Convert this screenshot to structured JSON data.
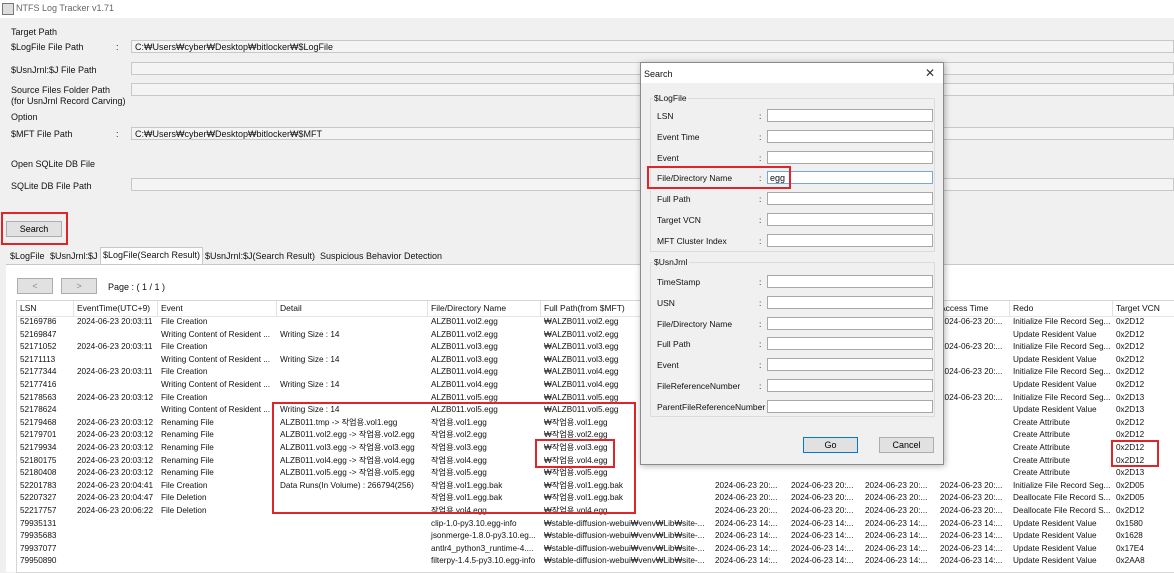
{
  "window": {
    "title": "NTFS Log Tracker v1.71"
  },
  "paths": {
    "target_path": "Target Path",
    "logfile_label": "$LogFile File Path",
    "logfile_value": "C:₩Users₩cyber₩Desktop₩bitlocker₩$LogFile",
    "usnjrnl_label": "$UsnJrnl:$J File Path",
    "usnjrnl_value": "",
    "source_label_1": "Source Files Folder Path",
    "source_label_2": "(for UsnJrnl Record Carving)",
    "source_value": "",
    "option": "Option",
    "mft_label": "$MFT File Path",
    "mft_value": "C:₩Users₩cyber₩Desktop₩bitlocker₩$MFT",
    "sqlite_open": "Open SQLite DB File",
    "sqlite_label": "SQLite DB File Path",
    "sqlite_value": "",
    "colon": ":"
  },
  "search_button": "Search",
  "tabs": [
    "$LogFile",
    "$UsnJrnl:$J",
    "$LogFile(Search Result)",
    "$UsnJrnl:$J(Search Result)",
    "Suspicious Behavior Detection"
  ],
  "active_tab": 2,
  "pager": {
    "prev": "<",
    "next": ">",
    "page_label": "Page : ( 1 / 1 )"
  },
  "table": {
    "columns": [
      "LSN",
      "EventTime(UTC+9)",
      "Event",
      "Detail",
      "File/Directory Name",
      "Full Path(from $MFT)",
      "",
      "",
      "",
      "Access Time",
      "Redo",
      "Target VCN"
    ],
    "rows": [
      [
        "52169786",
        "2024-06-23 20:03:11",
        "File Creation",
        "",
        "ALZB011.vol2.egg",
        "₩ALZB011.vol2.egg",
        "",
        "",
        "",
        "2024-06-23 20:...",
        "Initialize File Record Seg...",
        "0x2D12"
      ],
      [
        "52169847",
        "",
        "Writing Content of Resident ...",
        "Writing Size : 14",
        "ALZB011.vol2.egg",
        "₩ALZB011.vol2.egg",
        "",
        "",
        "",
        "",
        "Update Resident Value",
        "0x2D12"
      ],
      [
        "52171052",
        "2024-06-23 20:03:11",
        "File Creation",
        "",
        "ALZB011.vol3.egg",
        "₩ALZB011.vol3.egg",
        "",
        "",
        "",
        "2024-06-23 20:...",
        "Initialize File Record Seg...",
        "0x2D12"
      ],
      [
        "52171113",
        "",
        "Writing Content of Resident ...",
        "Writing Size : 14",
        "ALZB011.vol3.egg",
        "₩ALZB011.vol3.egg",
        "",
        "",
        "",
        "",
        "Update Resident Value",
        "0x2D12"
      ],
      [
        "52177344",
        "2024-06-23 20:03:11",
        "File Creation",
        "",
        "ALZB011.vol4.egg",
        "₩ALZB011.vol4.egg",
        "",
        "",
        "",
        "2024-06-23 20:...",
        "Initialize File Record Seg...",
        "0x2D12"
      ],
      [
        "52177416",
        "",
        "Writing Content of Resident ...",
        "Writing Size : 14",
        "ALZB011.vol4.egg",
        "₩ALZB011.vol4.egg",
        "",
        "",
        "",
        "",
        "Update Resident Value",
        "0x2D12"
      ],
      [
        "52178563",
        "2024-06-23 20:03:12",
        "File Creation",
        "",
        "ALZB011.vol5.egg",
        "₩ALZB011.vol5.egg",
        "",
        "",
        "",
        "2024-06-23 20:...",
        "Initialize File Record Seg...",
        "0x2D13"
      ],
      [
        "52178624",
        "",
        "Writing Content of Resident ...",
        "Writing Size : 14",
        "ALZB011.vol5.egg",
        "₩ALZB011.vol5.egg",
        "",
        "",
        "",
        "",
        "Update Resident Value",
        "0x2D13"
      ],
      [
        "52179468",
        "2024-06-23 20:03:12",
        "Renaming File",
        "ALZB011.tmp -> 작업용.vol1.egg",
        "작업용.vol1.egg",
        "₩작업용.vol1.egg",
        "",
        "",
        "",
        "",
        "Create Attribute",
        "0x2D12"
      ],
      [
        "52179701",
        "2024-06-23 20:03:12",
        "Renaming File",
        "ALZB011.vol2.egg -> 작업용.vol2.egg",
        "작업용.vol2.egg",
        "₩작업용.vol2.egg",
        "",
        "",
        "",
        "",
        "Create Attribute",
        "0x2D12"
      ],
      [
        "52179934",
        "2024-06-23 20:03:12",
        "Renaming File",
        "ALZB011.vol3.egg -> 작업용.vol3.egg",
        "작업용.vol3.egg",
        "₩작업용.vol3.egg",
        "",
        "",
        "",
        "",
        "Create Attribute",
        "0x2D12"
      ],
      [
        "52180175",
        "2024-06-23 20:03:12",
        "Renaming File",
        "ALZB011.vol4.egg -> 작업용.vol4.egg",
        "작업용.vol4.egg",
        "₩작업용.vol4.egg",
        "",
        "",
        "",
        "",
        "Create Attribute",
        "0x2D12"
      ],
      [
        "52180408",
        "2024-06-23 20:03:12",
        "Renaming File",
        "ALZB011.vol5.egg -> 작업용.vol5.egg",
        "작업용.vol5.egg",
        "₩작업용.vol5.egg",
        "",
        "",
        "",
        "",
        "Create Attribute",
        "0x2D13"
      ],
      [
        "52201783",
        "2024-06-23 20:04:41",
        "File Creation",
        "Data Runs(In Volume) : 266794(256)",
        "작업용.vol1.egg.bak",
        "₩작업용.vol1.egg.bak",
        "2024-06-23 20:...",
        "2024-06-23 20:...",
        "2024-06-23 20:...",
        "2024-06-23 20:...",
        "Initialize File Record Seg...",
        "0x2D05"
      ],
      [
        "52207327",
        "2024-06-23 20:04:47",
        "File Deletion",
        "",
        "작업용.vol1.egg.bak",
        "₩작업용.vol1.egg.bak",
        "2024-06-23 20:...",
        "2024-06-23 20:...",
        "2024-06-23 20:...",
        "2024-06-23 20:...",
        "Deallocate File Record S...",
        "0x2D05"
      ],
      [
        "52217757",
        "2024-06-23 20:06:22",
        "File Deletion",
        "",
        "작업용.vol4.egg",
        "₩작업용.vol4.egg",
        "2024-06-23 20:...",
        "2024-06-23 20:...",
        "2024-06-23 20:...",
        "2024-06-23 20:...",
        "Deallocate File Record S...",
        "0x2D12"
      ],
      [
        "79935131",
        "",
        "",
        "",
        "clip-1.0-py3.10.egg-info",
        "₩stable-diffusion-webui₩venv₩Lib₩site-...",
        "2024-06-23 14:...",
        "2024-06-23 14:...",
        "2024-06-23 14:...",
        "2024-06-23 14:...",
        "Update Resident Value",
        "0x1580"
      ],
      [
        "79935683",
        "",
        "",
        "",
        "jsonmerge-1.8.0-py3.10.eg...",
        "₩stable-diffusion-webui₩venv₩Lib₩site-...",
        "2024-06-23 14:...",
        "2024-06-23 14:...",
        "2024-06-23 14:...",
        "2024-06-23 14:...",
        "Update Resident Value",
        "0x1628"
      ],
      [
        "79937077",
        "",
        "",
        "",
        "antlr4_python3_runtime-4....",
        "₩stable-diffusion-webui₩venv₩Lib₩site-...",
        "2024-06-23 14:...",
        "2024-06-23 14:...",
        "2024-06-23 14:...",
        "2024-06-23 14:...",
        "Update Resident Value",
        "0x17E4"
      ],
      [
        "79950890",
        "",
        "",
        "",
        "filterpy-1.4.5-py3.10.egg-info",
        "₩stable-diffusion-webui₩venv₩Lib₩site-...",
        "2024-06-23 14:...",
        "2024-06-23 14:...",
        "2024-06-23 14:...",
        "2024-06-23 14:...",
        "Update Resident Value",
        "0x2AA8"
      ]
    ]
  },
  "dialog": {
    "title": "Search",
    "close": "✕",
    "logfile_group": "$LogFile",
    "logfile_fields": [
      {
        "label": "LSN",
        "value": ""
      },
      {
        "label": "Event Time",
        "value": ""
      },
      {
        "label": "Event",
        "value": ""
      },
      {
        "label": "File/Directory Name",
        "value": "egg"
      },
      {
        "label": "Full Path",
        "value": ""
      },
      {
        "label": "Target VCN",
        "value": ""
      },
      {
        "label": "MFT Cluster Index",
        "value": ""
      }
    ],
    "usn_group": "$UsnJrnl",
    "usn_fields": [
      {
        "label": "TimeStamp",
        "value": ""
      },
      {
        "label": "USN",
        "value": ""
      },
      {
        "label": "File/Directory Name",
        "value": ""
      },
      {
        "label": "Full Path",
        "value": ""
      },
      {
        "label": "Event",
        "value": ""
      },
      {
        "label": "FileReferenceNumber",
        "value": ""
      },
      {
        "label": "ParentFileReferenceNumber",
        "value": ""
      }
    ],
    "colon": ":",
    "go": "Go",
    "cancel": "Cancel"
  },
  "highlight_color": "#e0242c"
}
